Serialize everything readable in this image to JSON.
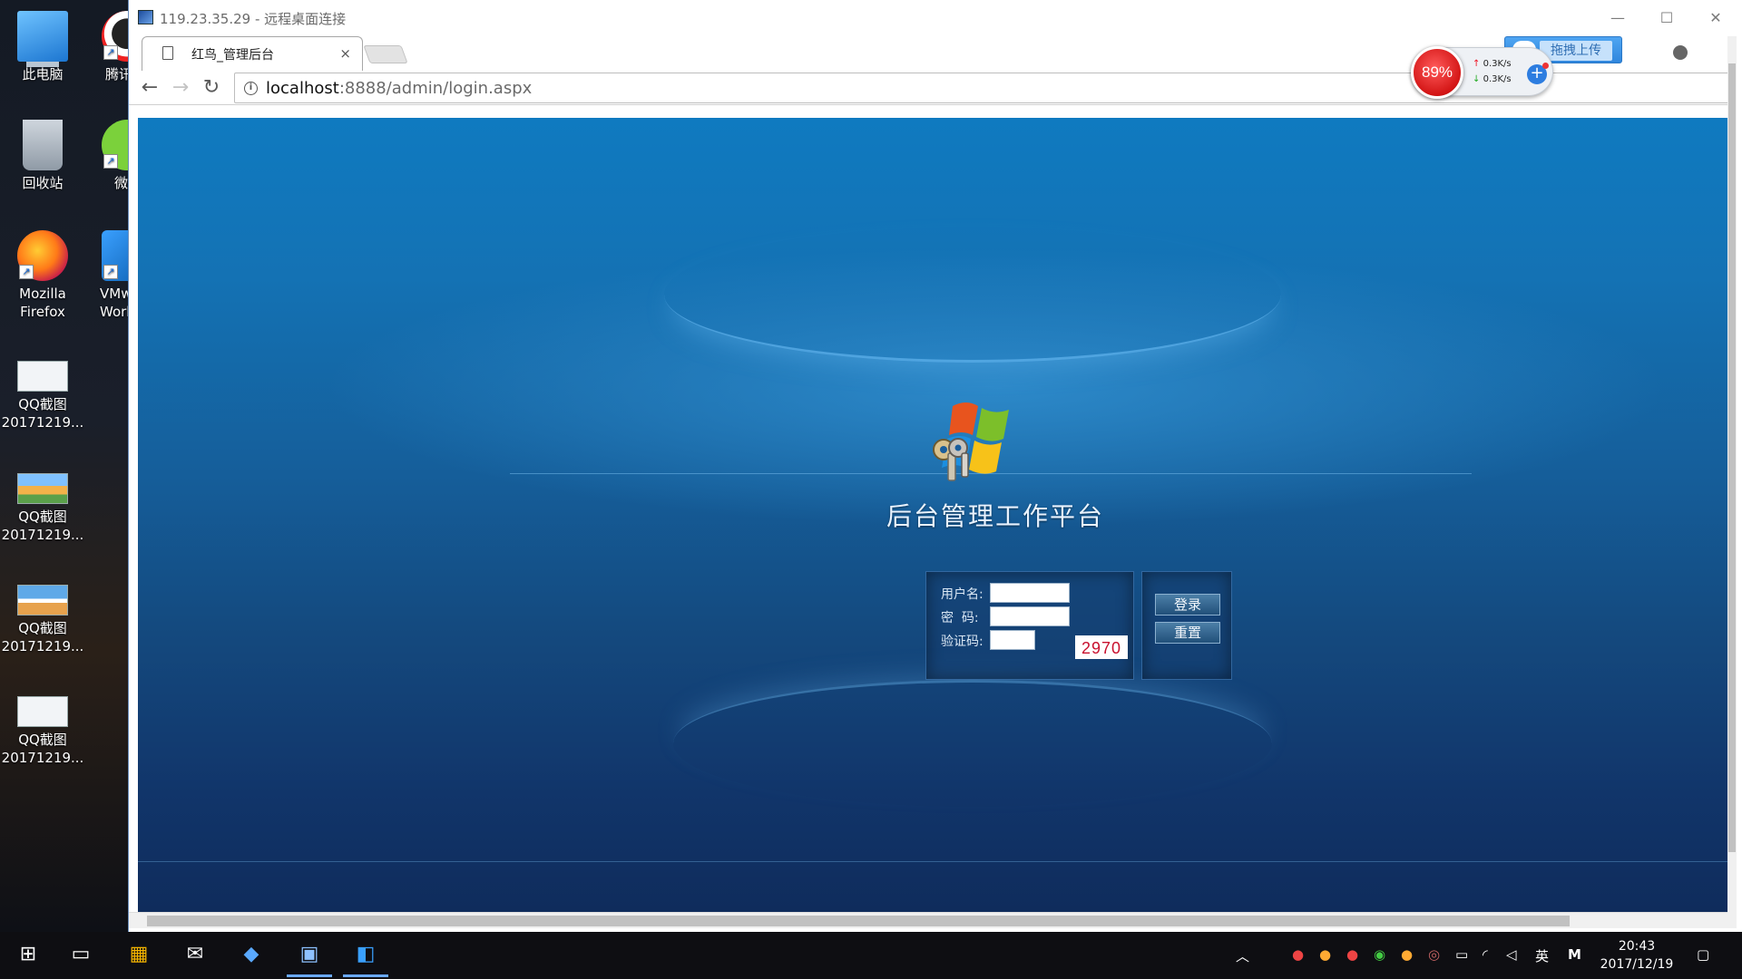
{
  "desktop": {
    "icons": [
      {
        "label": "此电脑",
        "icon": "computer-icon"
      },
      {
        "label": "回收站",
        "icon": "recycle-bin-icon"
      },
      {
        "label": "Mozilla Firefox",
        "icon": "firefox-icon"
      },
      {
        "label": "QQ截图 20171219...",
        "icon": "screenshot-icon"
      },
      {
        "label": "QQ截图 20171219...",
        "icon": "screenshot-icon"
      },
      {
        "label": "QQ截图 20171219...",
        "icon": "screenshot-icon"
      },
      {
        "label": "QQ截图 20171219...",
        "icon": "screenshot-icon"
      },
      {
        "label": "腾讯",
        "icon": "qq-icon"
      },
      {
        "label": "微",
        "icon": "wechat-icon"
      },
      {
        "label": "VMw Work",
        "icon": "vmware-icon"
      }
    ]
  },
  "remote_window": {
    "title": "119.23.35.29 - 远程桌面连接",
    "minimize": "—",
    "maximize": "☐",
    "close": "✕"
  },
  "browser": {
    "tab_title": "红鸟_管理后台",
    "tab_close": "×",
    "upload_label": "拖拽上传",
    "url_host": "localhost",
    "url_rest": ":8888/admin/login.aspx",
    "back": "←",
    "forward": "→",
    "reload": "↻"
  },
  "speed_widget": {
    "percent": "89%",
    "up": "0.3K/s",
    "down": "0.3K/s",
    "plus": "+"
  },
  "page": {
    "title": "后台管理工作平台",
    "username_label": "用户名:",
    "password_label": "密  码:",
    "captcha_label": "验证码:",
    "captcha_value": "2970",
    "login_button": "登录",
    "reset_button": "重置"
  },
  "taskbar": {
    "time": "20:43",
    "date": "2017/12/19",
    "ime": "英",
    "ime2": "M"
  },
  "colors": {
    "page_top": "#0f7ac0",
    "page_bottom": "#0f2c5c",
    "captcha_text": "#c8102e"
  }
}
